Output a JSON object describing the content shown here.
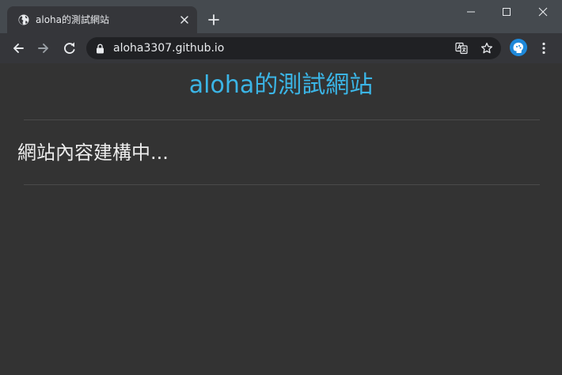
{
  "browser": {
    "tab": {
      "title": "aloha的測試網站",
      "favicon": "globe-icon"
    },
    "window_controls": [
      "minimize-icon",
      "maximize-icon",
      "close-icon"
    ],
    "address_bar": {
      "url": "aloha3307.github.io",
      "secure_icon": "lock-icon"
    },
    "toolbar_icons": [
      "back-arrow-icon",
      "forward-arrow-icon",
      "reload-icon",
      "translate-icon",
      "star-icon",
      "avatar",
      "menu-icon"
    ]
  },
  "page": {
    "heading": "aloha的測試網站",
    "body_text": "網站內容建構中..."
  },
  "colors": {
    "page_background": "#333333",
    "heading": "#3bb5e6",
    "body_text": "#ececec",
    "tab_strip": "#454a4f",
    "toolbar": "#35363a",
    "omnibox": "#202124"
  }
}
